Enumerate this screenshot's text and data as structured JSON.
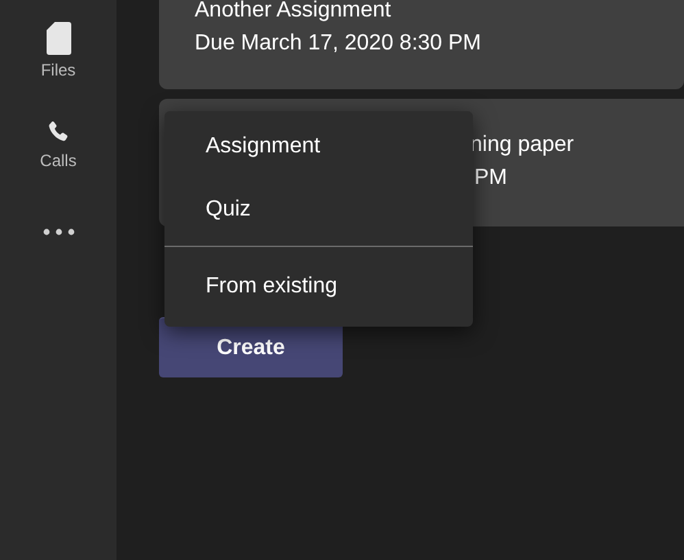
{
  "sidebar": {
    "items": [
      {
        "label": "Files",
        "kind": "file"
      },
      {
        "label": "Calls",
        "kind": "phone"
      },
      {
        "kind": "more"
      }
    ]
  },
  "assignments": [
    {
      "title": "Another Assignment",
      "due": "Due March 17, 2020 8:30 PM"
    },
    {
      "title": "ning paper",
      "due": "PM"
    }
  ],
  "menu": {
    "groups": [
      [
        "Assignment",
        "Quiz"
      ],
      [
        "From existing"
      ]
    ]
  },
  "create_button": "Create"
}
